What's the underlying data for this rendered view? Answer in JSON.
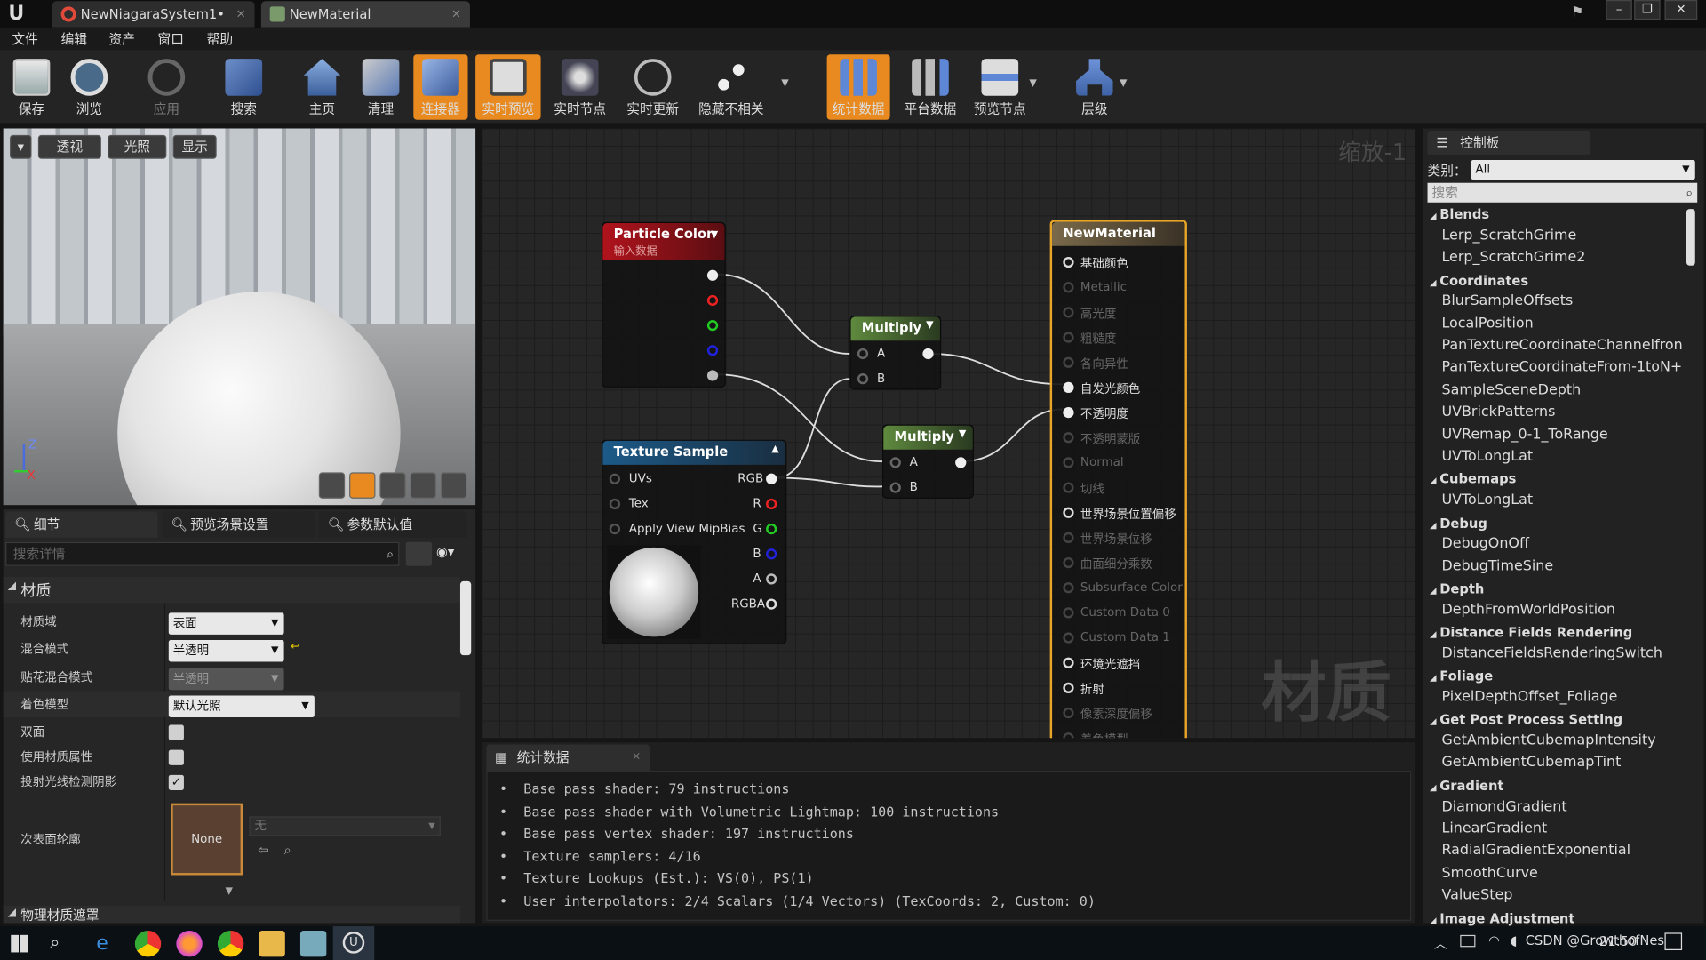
{
  "tabs": [
    {
      "label": "NewNiagaraSystem1•"
    },
    {
      "label": "NewMaterial"
    }
  ],
  "menu": [
    "文件",
    "编辑",
    "资产",
    "窗口",
    "帮助"
  ],
  "toolbar": [
    {
      "label": "保存",
      "icon": "save-icon"
    },
    {
      "label": "浏览",
      "icon": "browse-icon"
    },
    {
      "label": "应用",
      "icon": "apply-icon"
    },
    {
      "label": "搜索",
      "icon": "search-icon"
    },
    {
      "label": "主页",
      "icon": "home-icon"
    },
    {
      "label": "清理",
      "icon": "clean-icon"
    },
    {
      "label": "连接器",
      "icon": "connector-icon"
    },
    {
      "label": "实时预览",
      "icon": "live-preview-icon"
    },
    {
      "label": "实时节点",
      "icon": "live-nodes-icon"
    },
    {
      "label": "实时更新",
      "icon": "live-update-icon"
    },
    {
      "label": "隐藏不相关",
      "icon": "hide-unrelated-icon"
    },
    {
      "label": "统计数据",
      "icon": "stats-icon"
    },
    {
      "label": "平台数据",
      "icon": "platform-stats-icon"
    },
    {
      "label": "预览节点",
      "icon": "preview-node-icon"
    },
    {
      "label": "层级",
      "icon": "hierarchy-icon"
    }
  ],
  "viewport": {
    "perspective": "透视",
    "lit": "光照",
    "show": "显示"
  },
  "details": {
    "tabs": [
      "细节",
      "预览场景设置",
      "参数默认值"
    ],
    "search_placeholder": "搜索详情",
    "section": "材质",
    "props": [
      {
        "label": "材质域",
        "value": "表面"
      },
      {
        "label": "混合模式",
        "value": "半透明"
      },
      {
        "label": "贴花混合模式",
        "value": "半透明"
      },
      {
        "label": "着色模型",
        "value": "默认光照"
      },
      {
        "label": "双面"
      },
      {
        "label": "使用材质属性"
      },
      {
        "label": "投射光线检测阴影"
      },
      {
        "label": "次表面轮廓",
        "value": "无",
        "thumb": "None"
      }
    ],
    "section2": "物理材质遮罩"
  },
  "graph": {
    "zoom": "缩放-1",
    "watermark": "材质",
    "particle": {
      "title": "Particle Color",
      "subtitle": "输入数据"
    },
    "multiply1": {
      "title": "Multiply",
      "a": "A",
      "b": "B"
    },
    "multiply2": {
      "title": "Multiply",
      "a": "A",
      "b": "B"
    },
    "texture": {
      "title": "Texture Sample",
      "inputs": [
        "UVs",
        "Tex",
        "Apply View MipBias"
      ],
      "outputs": [
        "RGB",
        "R",
        "G",
        "B",
        "A",
        "RGBA"
      ]
    },
    "material": {
      "title": "NewMaterial",
      "pins": [
        "基础颜色",
        "Metallic",
        "高光度",
        "粗糙度",
        "各向异性",
        "自发光颜色",
        "不透明度",
        "不透明蒙版",
        "Normal",
        "切线",
        "世界场景位置偏移",
        "世界场景位移",
        "曲面细分乘数",
        "Subsurface Color",
        "Custom Data 0",
        "Custom Data 1",
        "环境光遮挡",
        "折射",
        "像素深度偏移",
        "着色模型"
      ]
    }
  },
  "stats": {
    "tab": "统计数据",
    "lines": [
      "Base pass shader: 79 instructions",
      "Base pass shader with Volumetric Lightmap: 100 instructions",
      "Base pass vertex shader: 197 instructions",
      "Texture samplers: 4/16",
      "Texture Lookups (Est.): VS(0), PS(1)",
      "User interpolators: 2/4 Scalars (1/4 Vectors) (TexCoords: 2, Custom: 0)"
    ]
  },
  "palette": {
    "tab": "控制板",
    "category_label": "类别：",
    "category_value": "All",
    "search_placeholder": "搜索",
    "groups": [
      {
        "name": "Blends",
        "items": [
          "Lerp_ScratchGrime",
          "Lerp_ScratchGrime2"
        ]
      },
      {
        "name": "Coordinates",
        "items": [
          "BlurSampleOffsets",
          "LocalPosition",
          "PanTextureCoordinateChannelfron",
          "PanTextureCoordinateFrom-1toN+",
          "SampleSceneDepth",
          "UVBrickPatterns",
          "UVRemap_0-1_ToRange",
          "UVToLongLat"
        ]
      },
      {
        "name": "Cubemaps",
        "items": [
          "UVToLongLat"
        ]
      },
      {
        "name": "Debug",
        "items": [
          "DebugOnOff",
          "DebugTimeSine"
        ]
      },
      {
        "name": "Depth",
        "items": [
          "DepthFromWorldPosition"
        ]
      },
      {
        "name": "Distance Fields Rendering",
        "items": [
          "DistanceFieldsRenderingSwitch"
        ]
      },
      {
        "name": "Foliage",
        "items": [
          "PixelDepthOffset_Foliage"
        ]
      },
      {
        "name": "Get Post Process Setting",
        "items": [
          "GetAmbientCubemapIntensity",
          "GetAmbientCubemapTint"
        ]
      },
      {
        "name": "Gradient",
        "items": [
          "DiamondGradient",
          "LinearGradient",
          "RadialGradientExponential",
          "SmoothCurve",
          "ValueStep"
        ]
      },
      {
        "name": "Image Adjustment",
        "items": []
      }
    ]
  },
  "taskbar": {
    "clock": "21:50",
    "tray_text": "CSDN @GrowthofNes"
  }
}
